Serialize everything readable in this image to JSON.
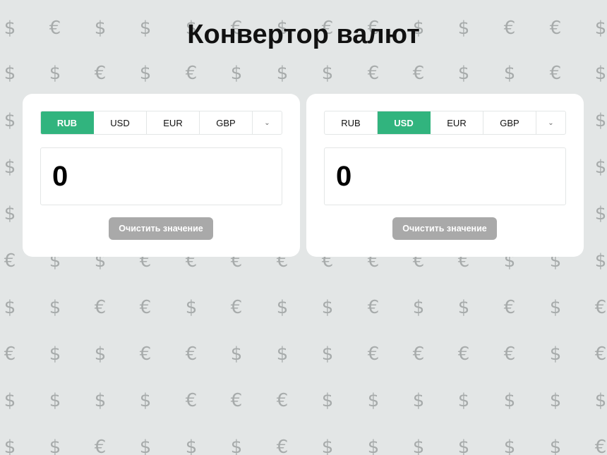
{
  "app": {
    "title": "Конвертор валют"
  },
  "background": {
    "glyphs": [
      "$",
      "€"
    ],
    "glyph_color": "#a7abab",
    "background_color": "#e3e6e6"
  },
  "colors": {
    "accent": "#31b47e",
    "button": "#a9a9a9"
  },
  "panels": [
    {
      "tabs": [
        {
          "label": "RUB",
          "active": true
        },
        {
          "label": "USD",
          "active": false
        },
        {
          "label": "EUR",
          "active": false
        },
        {
          "label": "GBP",
          "active": false
        }
      ],
      "more_icon": "⌄",
      "value": "0",
      "clear_label": "Очистить значение"
    },
    {
      "tabs": [
        {
          "label": "RUB",
          "active": false
        },
        {
          "label": "USD",
          "active": true
        },
        {
          "label": "EUR",
          "active": false
        },
        {
          "label": "GBP",
          "active": false
        }
      ],
      "more_icon": "⌄",
      "value": "0",
      "clear_label": "Очистить значение"
    }
  ]
}
